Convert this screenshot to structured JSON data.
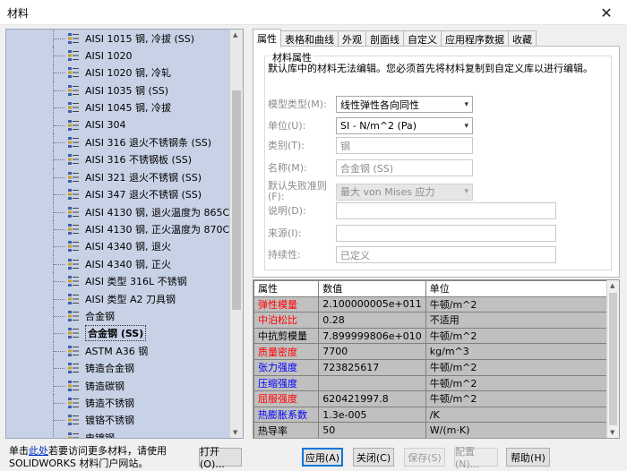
{
  "window": {
    "title": "材料"
  },
  "tree": {
    "items": [
      {
        "label": "AISI 1015 钢, 冷拔 (SS)"
      },
      {
        "label": "AISI 1020"
      },
      {
        "label": "AISI 1020 钢, 冷轧"
      },
      {
        "label": "AISI 1035 钢 (SS)"
      },
      {
        "label": "AISI 1045 钢, 冷拔"
      },
      {
        "label": "AISI 304"
      },
      {
        "label": "AISI 316 退火不锈钢条 (SS)"
      },
      {
        "label": "AISI 316 不锈钢板 (SS)"
      },
      {
        "label": "AISI 321 退火不锈钢 (SS)"
      },
      {
        "label": "AISI 347 退火不锈钢 (SS)"
      },
      {
        "label": "AISI 4130 钢, 退火温度为 865C"
      },
      {
        "label": "AISI 4130 钢, 正火温度为 870C"
      },
      {
        "label": "AISI 4340 钢, 退火"
      },
      {
        "label": "AISI 4340 钢, 正火"
      },
      {
        "label": "AISI 类型 316L 不锈钢"
      },
      {
        "label": "AISI 类型 A2 刀具钢"
      },
      {
        "label": "合金钢"
      },
      {
        "label": "合金钢 (SS)",
        "selected": true
      },
      {
        "label": "ASTM A36 钢"
      },
      {
        "label": "铸造合金钢"
      },
      {
        "label": "铸造碳钢"
      },
      {
        "label": "铸造不锈钢"
      },
      {
        "label": "镀铬不锈钢"
      },
      {
        "label": "电镀钢"
      }
    ]
  },
  "footer": {
    "note_prefix": "单击",
    "note_link": "此处",
    "note_suffix": "若要访问更多材料，请使用 SOLIDWORKS 材料门户网站。",
    "open_button": "打开(O)...",
    "apply_button": "应用(A)",
    "close_button": "关闭(C)",
    "save_button": "保存(S)",
    "config_button": "配置(N)...",
    "help_button": "帮助(H)"
  },
  "tabs": [
    {
      "label": "属性",
      "active": true
    },
    {
      "label": "表格和曲线"
    },
    {
      "label": "外观"
    },
    {
      "label": "剖面线"
    },
    {
      "label": "自定义"
    },
    {
      "label": "应用程序数据"
    },
    {
      "label": "收藏"
    }
  ],
  "properties": {
    "group_title": "材料属性",
    "notice": "默认库中的材料无法编辑。您必须首先将材料复制到自定义库以进行编辑。",
    "model_type_label": "模型类型(M):",
    "model_type_value": "线性弹性各向同性",
    "units_label": "单位(U):",
    "units_value": "SI - N/m^2 (Pa)",
    "category_label": "类别(T):",
    "category_value": "钢",
    "name_label": "名称(M):",
    "name_value": "合金钢 (SS)",
    "failure_label": "默认失败准则(F):",
    "failure_value": "最大 von Mises 应力",
    "description_label": "说明(D):",
    "description_value": "",
    "source_label": "来源(I):",
    "source_value": "",
    "sustainability_label": "持续性:",
    "sustainability_value": "已定义"
  },
  "table": {
    "headers": [
      "属性",
      "数值",
      "单位"
    ],
    "rows": [
      {
        "name": "弹性模量",
        "value": "2.100000005e+011",
        "unit": "牛顿/m^2",
        "color": "#ff0000"
      },
      {
        "name": "中泊松比",
        "value": "0.28",
        "unit": "不适用",
        "color": "#ff0000"
      },
      {
        "name": "中抗剪模量",
        "value": "7.899999806e+010",
        "unit": "牛顿/m^2",
        "color": "#000000"
      },
      {
        "name": "质量密度",
        "value": "7700",
        "unit": "kg/m^3",
        "color": "#ff0000"
      },
      {
        "name": "张力强度",
        "value": "723825617",
        "unit": "牛顿/m^2",
        "color": "#0000ff"
      },
      {
        "name": "压缩强度",
        "value": "",
        "unit": "牛顿/m^2",
        "color": "#0000ff"
      },
      {
        "name": "屈服强度",
        "value": "620421997.8",
        "unit": "牛顿/m^2",
        "color": "#ff0000"
      },
      {
        "name": "热膨胀系数",
        "value": "1.3e-005",
        "unit": "/K",
        "color": "#0000ff"
      },
      {
        "name": "热导率",
        "value": "50",
        "unit": "W/(m·K)",
        "color": "#000000"
      }
    ]
  }
}
